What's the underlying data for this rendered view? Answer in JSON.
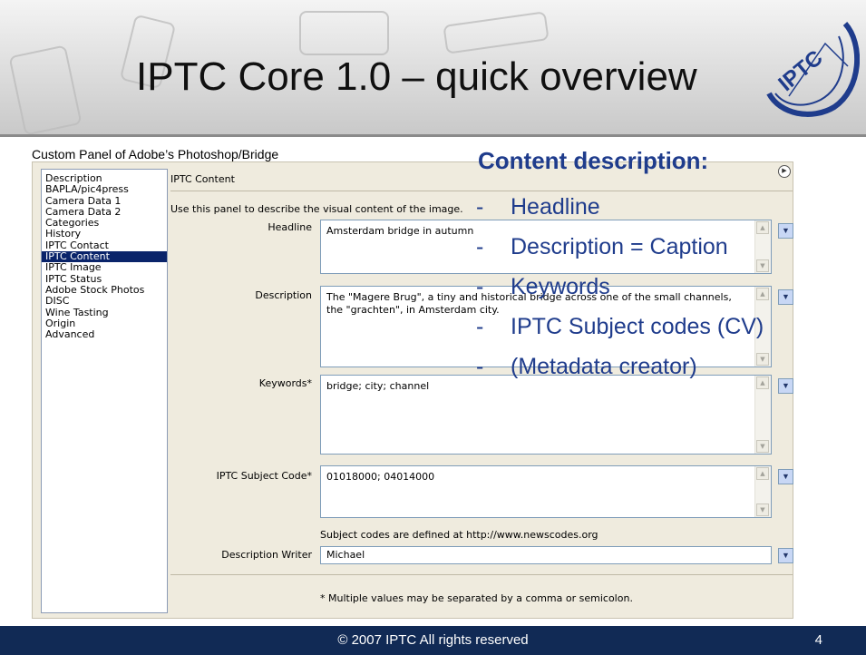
{
  "slide": {
    "title": "IPTC Core 1.0 – quick overview",
    "caption": "Custom Panel of Adobe’s Photoshop/Bridge",
    "logo_text": "IPTC"
  },
  "panel": {
    "sidebar_items": [
      "Description",
      "BAPLA/pic4press",
      "Camera Data 1",
      "Camera Data 2",
      "Categories",
      "History",
      "IPTC Contact",
      "IPTC Content",
      "IPTC Image",
      "IPTC Status",
      "Adobe Stock Photos",
      "DISC",
      "Wine Tasting",
      "Origin",
      "Advanced"
    ],
    "active_item": "IPTC Content",
    "title": "IPTC Content",
    "intro": "Use this panel to describe the visual content of the image.",
    "fields": {
      "headline": {
        "label": "Headline",
        "value": "Amsterdam bridge in autumn"
      },
      "description": {
        "label": "Description",
        "value": "The \"Magere Brug\", a tiny and historical bridge across one of the small channels, the \"grachten\", in Amsterdam city."
      },
      "keywords": {
        "label": "Keywords*",
        "value": "bridge; city; channel"
      },
      "subject_code": {
        "label": "IPTC Subject Code*",
        "value": "01018000; 04014000"
      },
      "writer": {
        "label": "Description Writer",
        "value": "Michael"
      }
    },
    "subject_hint": "Subject codes are defined at http://www.newscodes.org",
    "footnote": "* Multiple values may be separated by a comma or semicolon."
  },
  "overlay": {
    "title": "Content description:",
    "items": [
      "Headline",
      "Description = Caption",
      "Keywords",
      "IPTC Subject codes (CV)",
      "(Metadata creator)"
    ],
    "dash": "-"
  },
  "footer": {
    "copyright": "© 2007 IPTC All rights reserved",
    "page": "4"
  },
  "colors": {
    "accent": "#1f3c8c",
    "footer_bg": "#112a55",
    "panel_bg": "#efebde",
    "selection": "#0a246a"
  }
}
